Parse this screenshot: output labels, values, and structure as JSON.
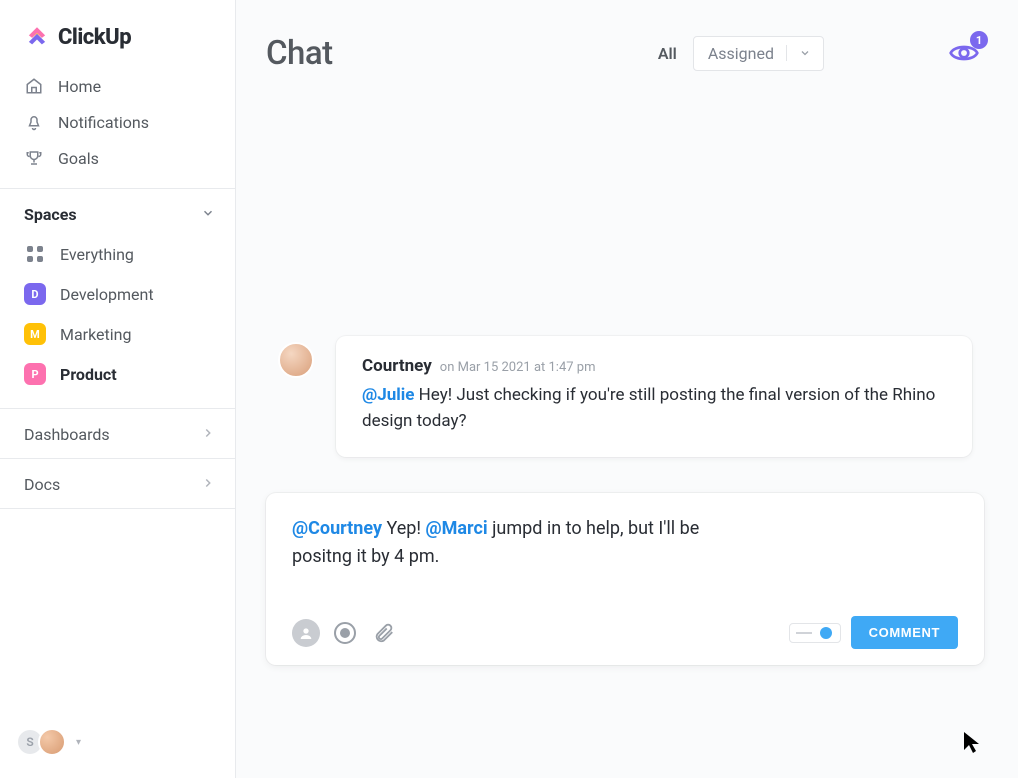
{
  "brand": {
    "name": "ClickUp"
  },
  "nav": {
    "home": "Home",
    "notifications": "Notifications",
    "goals": "Goals"
  },
  "spaces": {
    "header": "Spaces",
    "everything": "Everything",
    "items": [
      {
        "letter": "D",
        "label": "Development",
        "color": "#7b68ee"
      },
      {
        "letter": "M",
        "label": "Marketing",
        "color": "#ffc107"
      },
      {
        "letter": "P",
        "label": "Product",
        "color": "#fd71af"
      }
    ]
  },
  "sections": {
    "dashboards": "Dashboards",
    "docs": "Docs"
  },
  "workspace": {
    "initial": "S"
  },
  "header": {
    "title": "Chat",
    "all": "All",
    "assigned": "Assigned",
    "watchers_count": "1"
  },
  "colors": {
    "accent": "#7b68ee",
    "mention_blue": "#1e88e5",
    "comment_btn": "#3fa9f5"
  },
  "message": {
    "author": "Courtney",
    "timestamp": "on Mar 15 2021 at 1:47 pm",
    "mention": "@Julie",
    "text": " Hey! Just checking if you're still posting the final version of the Rhino design today?"
  },
  "composer": {
    "mention1": "@Courtney",
    "text1": " Yep! ",
    "mention2": "@Marci",
    "text2": " jumpd in to help, but I'll be positng it by 4 pm.",
    "button": "COMMENT"
  }
}
